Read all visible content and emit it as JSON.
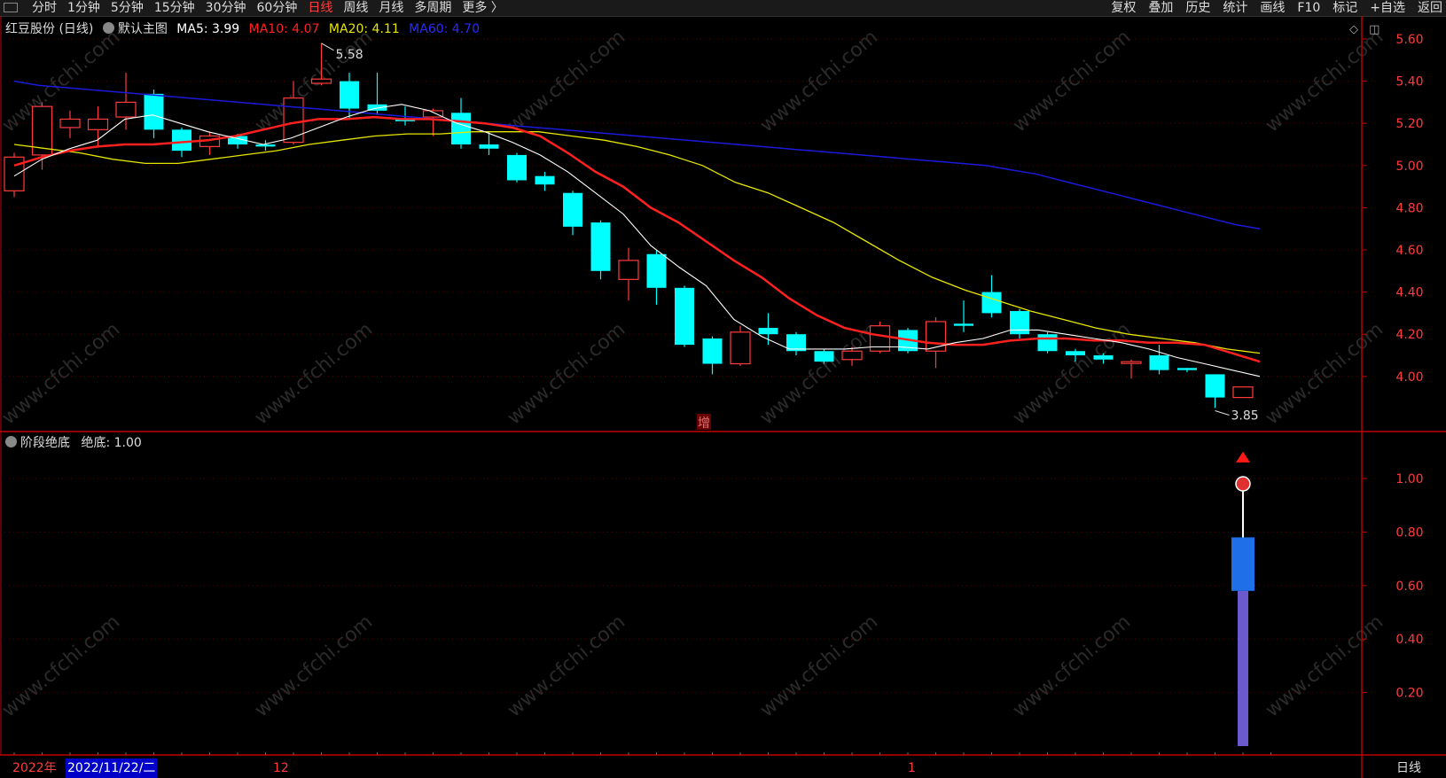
{
  "toolbar": {
    "periods": [
      "分时",
      "1分钟",
      "5分钟",
      "15分钟",
      "30分钟",
      "60分钟",
      "日线",
      "周线",
      "月线",
      "多周期",
      "更多 〉"
    ],
    "active_period": "日线",
    "tools": [
      "复权",
      "叠加",
      "历史",
      "统计",
      "画线",
      "F10",
      "标记",
      "+自选",
      "返回"
    ]
  },
  "main_legend": {
    "stock": "红豆股份 (日线)",
    "theme": "默认主图",
    "ma5": "MA5: 3.99",
    "ma10": "MA10: 4.07",
    "ma20": "MA20: 4.11",
    "ma60": "MA60: 4.70"
  },
  "sub_legend": {
    "name": "阶段绝底",
    "value": "绝底: 1.00"
  },
  "annotations": {
    "high": "5.58",
    "low": "3.85",
    "marker": "增"
  },
  "bottom": {
    "year": "2022年",
    "date": "2022/11/22/二",
    "month12": "12",
    "month1": "1",
    "period_button": "日线"
  },
  "watermark": "www.cfchi.com",
  "colors": {
    "up": "#ff3b3b",
    "down": "#00ffff",
    "ma5": "#ffffff",
    "ma10": "#ff2020",
    "ma20": "#e6e600",
    "ma60": "#1a1adc",
    "axis": "#c00000",
    "bar_low": "#6a5acd",
    "bar_high": "#1e6fe8"
  },
  "chart_data": [
    {
      "type": "candlestick",
      "ylim": [
        3.8,
        5.7
      ],
      "yticks": [
        "5.60",
        "5.40",
        "5.20",
        "5.00",
        "4.80",
        "4.60",
        "4.40",
        "4.20",
        "4.00"
      ],
      "candles": [
        [
          4.88,
          5.04,
          4.85,
          5.06
        ],
        [
          5.05,
          5.28,
          4.98,
          5.3
        ],
        [
          5.18,
          5.22,
          5.13,
          5.26
        ],
        [
          5.17,
          5.22,
          5.09,
          5.28
        ],
        [
          5.23,
          5.3,
          5.17,
          5.44
        ],
        [
          5.34,
          5.17,
          5.13,
          5.36
        ],
        [
          5.17,
          5.07,
          5.04,
          5.18
        ],
        [
          5.09,
          5.14,
          5.05,
          5.16
        ],
        [
          5.14,
          5.1,
          5.08,
          5.15
        ],
        [
          5.1,
          5.09,
          5.07,
          5.12
        ],
        [
          5.11,
          5.32,
          5.1,
          5.4
        ],
        [
          5.39,
          5.41,
          5.38,
          5.58
        ],
        [
          5.4,
          5.27,
          5.22,
          5.44
        ],
        [
          5.29,
          5.26,
          5.24,
          5.44
        ],
        [
          5.22,
          5.21,
          5.19,
          5.28
        ],
        [
          5.23,
          5.26,
          5.14,
          5.27
        ],
        [
          5.25,
          5.1,
          5.08,
          5.32
        ],
        [
          5.1,
          5.08,
          5.05,
          5.16
        ],
        [
          5.05,
          4.93,
          4.92,
          5.06
        ],
        [
          4.95,
          4.91,
          4.88,
          4.97
        ],
        [
          4.87,
          4.71,
          4.67,
          4.88
        ],
        [
          4.73,
          4.5,
          4.46,
          4.74
        ],
        [
          4.46,
          4.55,
          4.36,
          4.61
        ],
        [
          4.58,
          4.42,
          4.34,
          4.6
        ],
        [
          4.42,
          4.15,
          4.14,
          4.43
        ],
        [
          4.18,
          4.06,
          4.01,
          4.19
        ],
        [
          4.06,
          4.21,
          4.05,
          4.24
        ],
        [
          4.23,
          4.2,
          4.15,
          4.3
        ],
        [
          4.2,
          4.12,
          4.1,
          4.21
        ],
        [
          4.12,
          4.07,
          4.06,
          4.13
        ],
        [
          4.08,
          4.12,
          4.05,
          4.14
        ],
        [
          4.12,
          4.24,
          4.11,
          4.26
        ],
        [
          4.22,
          4.12,
          4.11,
          4.23
        ],
        [
          4.12,
          4.26,
          4.04,
          4.28
        ],
        [
          4.25,
          4.24,
          4.21,
          4.36
        ],
        [
          4.4,
          4.3,
          4.28,
          4.48
        ],
        [
          4.31,
          4.2,
          4.18,
          4.32
        ],
        [
          4.2,
          4.12,
          4.11,
          4.21
        ],
        [
          4.12,
          4.1,
          4.07,
          4.13
        ],
        [
          4.1,
          4.08,
          4.06,
          4.11
        ],
        [
          4.07,
          4.07,
          3.99,
          4.08
        ],
        [
          4.1,
          4.03,
          4.01,
          4.15
        ],
        [
          4.04,
          4.03,
          4.02,
          4.04
        ],
        [
          4.01,
          3.9,
          3.85,
          4.01
        ],
        [
          3.9,
          3.95,
          3.9,
          3.95
        ]
      ],
      "ma5": [
        4.95,
        5.03,
        5.08,
        5.12,
        5.22,
        5.24,
        5.2,
        5.16,
        5.13,
        5.1,
        5.13,
        5.18,
        5.23,
        5.27,
        5.29,
        5.26,
        5.2,
        5.16,
        5.11,
        5.05,
        4.97,
        4.87,
        4.77,
        4.62,
        4.52,
        4.43,
        4.27,
        4.19,
        4.13,
        4.13,
        4.13,
        4.14,
        4.14,
        4.13,
        4.16,
        4.18,
        4.22,
        4.22,
        4.2,
        4.18,
        4.16,
        4.13,
        4.09,
        4.06,
        4.03,
        4.0
      ],
      "ma10": [
        5.0,
        5.04,
        5.07,
        5.09,
        5.1,
        5.1,
        5.11,
        5.12,
        5.14,
        5.17,
        5.2,
        5.22,
        5.22,
        5.23,
        5.22,
        5.22,
        5.21,
        5.2,
        5.18,
        5.14,
        5.06,
        4.97,
        4.9,
        4.8,
        4.73,
        4.64,
        4.55,
        4.47,
        4.37,
        4.29,
        4.23,
        4.2,
        4.18,
        4.16,
        4.15,
        4.15,
        4.17,
        4.18,
        4.18,
        4.17,
        4.17,
        4.16,
        4.16,
        4.15,
        4.11,
        4.07
      ],
      "ma20": [
        5.1,
        5.08,
        5.06,
        5.03,
        5.01,
        5.01,
        5.03,
        5.05,
        5.07,
        5.1,
        5.12,
        5.14,
        5.15,
        5.15,
        5.16,
        5.16,
        5.16,
        5.14,
        5.12,
        5.09,
        5.05,
        5.0,
        4.92,
        4.87,
        4.8,
        4.73,
        4.64,
        4.55,
        4.47,
        4.41,
        4.36,
        4.31,
        4.27,
        4.23,
        4.2,
        4.18,
        4.16,
        4.13,
        4.11
      ],
      "ma60": [
        5.4,
        5.38,
        5.37,
        5.36,
        5.35,
        5.34,
        5.33,
        5.32,
        5.31,
        5.3,
        5.29,
        5.28,
        5.27,
        5.26,
        5.25,
        5.24,
        5.23,
        5.22,
        5.21,
        5.2,
        5.19,
        5.18,
        5.17,
        5.16,
        5.15,
        5.14,
        5.13,
        5.12,
        5.11,
        5.1,
        5.09,
        5.08,
        5.07,
        5.06,
        5.05,
        5.04,
        5.03,
        5.02,
        5.01,
        5.0,
        4.98,
        4.96,
        4.93,
        4.9,
        4.87,
        4.84,
        4.81,
        4.78,
        4.75,
        4.72,
        4.7
      ]
    },
    {
      "type": "bar",
      "title": "阶段绝底",
      "ylim": [
        0,
        1.15
      ],
      "yticks": [
        "1.00",
        "0.80",
        "0.60",
        "0.40",
        "0.20"
      ],
      "bar_index": 44,
      "bar_low_part": [
        0,
        0.58
      ],
      "bar_high_part": [
        0.58,
        0.78
      ],
      "line_top": 0.98,
      "signal_value": 1.0
    }
  ]
}
